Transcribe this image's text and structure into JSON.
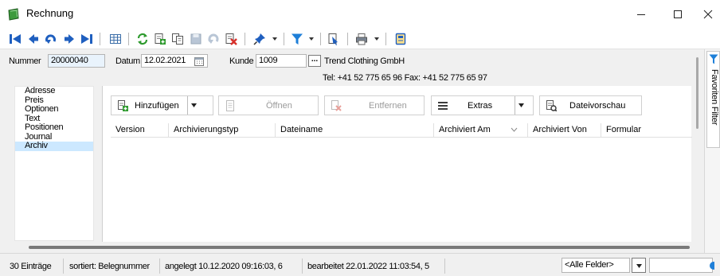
{
  "window": {
    "title": "Rechnung",
    "minimize_icon": "minimize-icon",
    "maximize_icon": "maximize-icon",
    "close_icon": "close-icon"
  },
  "toolbar": {
    "icons": [
      "first-record-icon",
      "previous-record-icon",
      "jump-icon",
      "next-record-icon",
      "last-record-icon",
      "table-view-icon",
      "refresh-icon",
      "new-record-icon",
      "copy-record-icon",
      "save-icon",
      "undo-icon",
      "delete-icon",
      "pin-icon",
      "filter-icon",
      "export-icon",
      "print-icon",
      "archive-icon"
    ]
  },
  "header": {
    "nummer_label": "Nummer",
    "nummer_value": "20000040",
    "datum_label": "Datum",
    "datum_value": "12.02.2021",
    "kunde_label": "Kunde",
    "kunde_value": "1009",
    "lookup_label": "...",
    "kunde_name": "Trend Clothing GmbH",
    "kunde_contact": "Tel: +41 52 775 65 96  Fax: +41 52 775 65 97"
  },
  "nav": {
    "items": [
      "Adresse",
      "Preis",
      "Optionen",
      "Text",
      "Positionen",
      "Journal",
      "Archiv"
    ],
    "selected": "Archiv"
  },
  "panel": {
    "add_label": "Hinzufügen",
    "open_label": "Öffnen",
    "remove_label": "Entfernen",
    "extras_label": "Extras",
    "preview_label": "Dateivorschau"
  },
  "grid": {
    "columns": [
      "Version",
      "Archivierungstyp",
      "Dateiname",
      "Archiviert Am",
      "Archiviert Von",
      "Formular"
    ]
  },
  "sidebar": {
    "label": "Favoriten Filter"
  },
  "status": {
    "count": "30 Einträge",
    "sorted": "sortiert: Belegnummer",
    "created": "angelegt 10.12.2020 09:16:03,  6",
    "edited": "bearbeitet 22.01.2022 11:03:54,  5",
    "field_select": "<Alle Felder>"
  },
  "colors": {
    "selection": "#cce8ff",
    "nav_blue": "#1f5fbf",
    "refresh_green": "#2e9a2e",
    "delete_red": "#d9312b",
    "filter_blue": "#1e7fd8"
  }
}
